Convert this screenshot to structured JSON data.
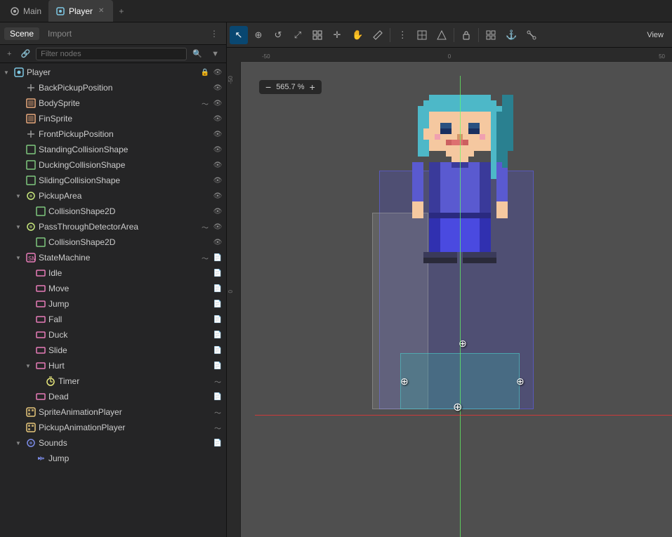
{
  "tabs": {
    "items": [
      {
        "label": "Main",
        "icon": "scene-icon",
        "active": false,
        "closeable": false
      },
      {
        "label": "Player",
        "icon": "player-icon",
        "active": true,
        "closeable": true
      }
    ],
    "add_label": "+"
  },
  "left_panel": {
    "tabs": [
      {
        "label": "Scene",
        "active": true
      },
      {
        "label": "Import",
        "active": false
      }
    ],
    "filter_placeholder": "Filter nodes",
    "tree": [
      {
        "id": "player",
        "label": "Player",
        "indent": 0,
        "expanded": true,
        "icon": "player",
        "has_expand": true,
        "icons_right": [
          "eye-visible",
          "lock"
        ]
      },
      {
        "id": "backpickup",
        "label": "BackPickupPosition",
        "indent": 1,
        "expanded": false,
        "icon": "position",
        "icons_right": [
          "eye-visible"
        ]
      },
      {
        "id": "bodysprite",
        "label": "BodySprite",
        "indent": 1,
        "expanded": false,
        "icon": "sprite",
        "icons_right": [
          "signal",
          "eye-visible"
        ]
      },
      {
        "id": "finsprite",
        "label": "FinSprite",
        "indent": 1,
        "expanded": false,
        "icon": "sprite",
        "icons_right": [
          "eye-visible"
        ]
      },
      {
        "id": "frontpickup",
        "label": "FrontPickupPosition",
        "indent": 1,
        "expanded": false,
        "icon": "position",
        "icons_right": [
          "eye-visible"
        ]
      },
      {
        "id": "standingcollision",
        "label": "StandingCollisionShape",
        "indent": 1,
        "expanded": false,
        "icon": "collision",
        "icons_right": [
          "eye-visible"
        ]
      },
      {
        "id": "duckingcollision",
        "label": "DuckingCollisionShape",
        "indent": 1,
        "expanded": false,
        "icon": "collision",
        "icons_right": [
          "eye-visible"
        ]
      },
      {
        "id": "slidingcollision",
        "label": "SlidingCollisionShape",
        "indent": 1,
        "expanded": false,
        "icon": "collision",
        "icons_right": [
          "eye-visible"
        ]
      },
      {
        "id": "pickuparea",
        "label": "PickupArea",
        "indent": 1,
        "expanded": true,
        "icon": "area",
        "has_expand": true,
        "icons_right": [
          "eye-visible"
        ]
      },
      {
        "id": "pickuparea-collision",
        "label": "CollisionShape2D",
        "indent": 2,
        "expanded": false,
        "icon": "collision",
        "icons_right": [
          "eye-visible"
        ]
      },
      {
        "id": "passthroughdetector",
        "label": "PassThroughDetectorArea",
        "indent": 1,
        "expanded": true,
        "icon": "area",
        "has_expand": true,
        "icons_right": [
          "signal",
          "eye-visible"
        ]
      },
      {
        "id": "passthrough-collision",
        "label": "CollisionShape2D",
        "indent": 2,
        "expanded": false,
        "icon": "collision",
        "icons_right": [
          "eye-visible"
        ]
      },
      {
        "id": "statemachine",
        "label": "StateMachine",
        "indent": 1,
        "expanded": true,
        "icon": "state",
        "has_expand": true,
        "icons_right": [
          "signal",
          "script"
        ]
      },
      {
        "id": "idle",
        "label": "Idle",
        "indent": 2,
        "expanded": false,
        "icon": "state-child",
        "icons_right": [
          "script"
        ]
      },
      {
        "id": "move",
        "label": "Move",
        "indent": 2,
        "expanded": false,
        "icon": "state-child",
        "icons_right": [
          "script"
        ]
      },
      {
        "id": "jump",
        "label": "Jump",
        "indent": 2,
        "expanded": false,
        "icon": "state-child",
        "icons_right": [
          "script"
        ]
      },
      {
        "id": "fall",
        "label": "Fall",
        "indent": 2,
        "expanded": false,
        "icon": "state-child",
        "icons_right": [
          "script"
        ]
      },
      {
        "id": "duck",
        "label": "Duck",
        "indent": 2,
        "expanded": false,
        "icon": "state-child",
        "icons_right": [
          "script"
        ]
      },
      {
        "id": "slide",
        "label": "Slide",
        "indent": 2,
        "expanded": false,
        "icon": "state-child",
        "icons_right": [
          "script"
        ]
      },
      {
        "id": "hurt",
        "label": "Hurt",
        "indent": 2,
        "expanded": true,
        "icon": "state-child",
        "has_expand": true,
        "icons_right": [
          "script"
        ]
      },
      {
        "id": "timer",
        "label": "Timer",
        "indent": 3,
        "expanded": false,
        "icon": "timer",
        "icons_right": [
          "signal"
        ]
      },
      {
        "id": "dead",
        "label": "Dead",
        "indent": 2,
        "expanded": false,
        "icon": "state-child",
        "icons_right": [
          "script"
        ]
      },
      {
        "id": "spriteanimation",
        "label": "SpriteAnimationPlayer",
        "indent": 1,
        "expanded": false,
        "icon": "animation",
        "icons_right": [
          "signal"
        ]
      },
      {
        "id": "pickupanimation",
        "label": "PickupAnimationPlayer",
        "indent": 1,
        "expanded": false,
        "icon": "animation",
        "icons_right": [
          "signal"
        ]
      },
      {
        "id": "sounds",
        "label": "Sounds",
        "indent": 1,
        "expanded": true,
        "icon": "audio",
        "has_expand": true,
        "icons_right": [
          "script"
        ]
      },
      {
        "id": "jump-sound",
        "label": "Jump",
        "indent": 2,
        "expanded": false,
        "icon": "sound-file",
        "icons_right": []
      }
    ]
  },
  "toolbar": {
    "tools": [
      {
        "id": "select",
        "icon": "↖",
        "active": true,
        "label": "Select tool"
      },
      {
        "id": "move",
        "icon": "⊕",
        "active": false,
        "label": "Move tool"
      },
      {
        "id": "rotate",
        "icon": "↺",
        "active": false,
        "label": "Rotate tool"
      },
      {
        "id": "scale",
        "icon": "⤢",
        "active": false,
        "label": "Scale tool"
      },
      {
        "id": "transform-group",
        "icon": "⊞",
        "active": false,
        "label": "Transform"
      },
      {
        "id": "pivot",
        "icon": "✛",
        "active": false,
        "label": "Pivot"
      },
      {
        "id": "pan",
        "icon": "✋",
        "active": false,
        "label": "Pan"
      },
      {
        "id": "ruler",
        "icon": "📐",
        "active": false,
        "label": "Ruler"
      },
      {
        "id": "group1",
        "sep": true
      },
      {
        "id": "snap1",
        "icon": "⋮",
        "active": false,
        "label": "Snap"
      },
      {
        "id": "snap2",
        "icon": "⊡",
        "active": false,
        "label": "Snap2"
      },
      {
        "id": "snap3",
        "icon": "⊟",
        "active": false,
        "label": "Snap3"
      },
      {
        "id": "group2",
        "sep": true
      },
      {
        "id": "lock",
        "icon": "🔒",
        "active": false,
        "label": "Lock"
      },
      {
        "id": "group3",
        "sep": true
      },
      {
        "id": "vis1",
        "icon": "⊞",
        "active": false,
        "label": "Visibility1"
      },
      {
        "id": "anchor",
        "icon": "⚓",
        "active": false,
        "label": "Anchor"
      },
      {
        "id": "bone",
        "icon": "🦴",
        "active": false,
        "label": "Bone"
      }
    ],
    "view_label": "View"
  },
  "viewport": {
    "zoom_label": "565.7 %",
    "zoom_minus": "−",
    "zoom_plus": "+",
    "ruler_marks_h": [
      "-50",
      "0",
      "50"
    ],
    "ruler_marks_v": [
      "-50",
      "0"
    ]
  },
  "colors": {
    "bg": "#4a4a4a",
    "selected": "#094771",
    "accent": "#5a9fd4",
    "collision_blue": "rgba(80,80,200,0.35)",
    "collision_teal": "rgba(60,160,160,0.4)"
  }
}
